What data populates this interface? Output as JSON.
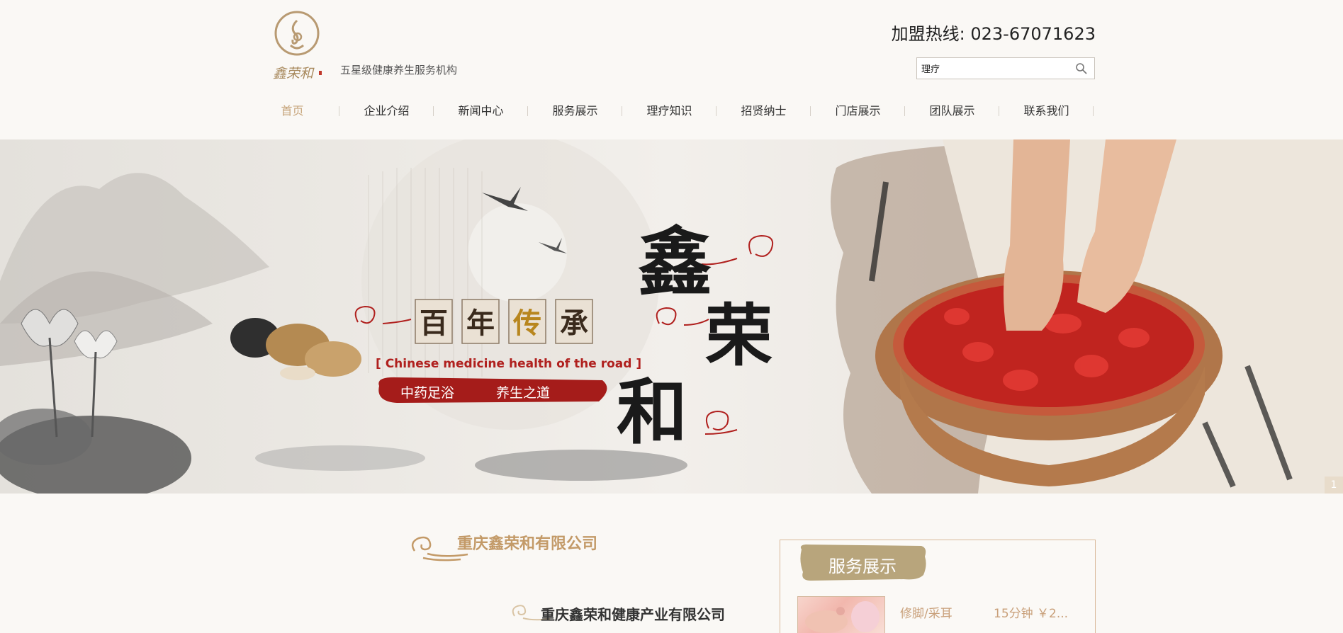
{
  "header": {
    "brand_name": "鑫荣和",
    "tagline": "五星级健康养生服务机构",
    "hotline": "加盟热线: 023-67071623",
    "search": {
      "value": "理疗",
      "icon": "search-icon"
    }
  },
  "nav": {
    "items": [
      {
        "label": "首页",
        "active": true
      },
      {
        "label": "企业介绍"
      },
      {
        "label": "新闻中心"
      },
      {
        "label": "服务展示"
      },
      {
        "label": "理疗知识"
      },
      {
        "label": "招贤纳士"
      },
      {
        "label": "门店展示"
      },
      {
        "label": "团队展示"
      },
      {
        "label": "联系我们"
      }
    ]
  },
  "banner": {
    "stamp_chars": [
      "百",
      "年",
      "传",
      "承"
    ],
    "english": "[ Chinese medicine health of the road ]",
    "ribbon_left": "中药足浴",
    "ribbon_right": "养生之道",
    "calligraphy": [
      "鑫",
      "荣",
      "和"
    ],
    "slide_index": "1"
  },
  "content": {
    "company_heading": "重庆鑫荣和有限公司",
    "company_sub": "重庆鑫荣和健康产业有限公司"
  },
  "services": {
    "title": "服务展示",
    "items": [
      {
        "name": "修脚/采耳",
        "price": "15分钟 ￥2..."
      }
    ]
  },
  "colors": {
    "accent_gold": "#c6a47a",
    "heading_gold": "#c39a68",
    "brand_red": "#b0201e"
  }
}
